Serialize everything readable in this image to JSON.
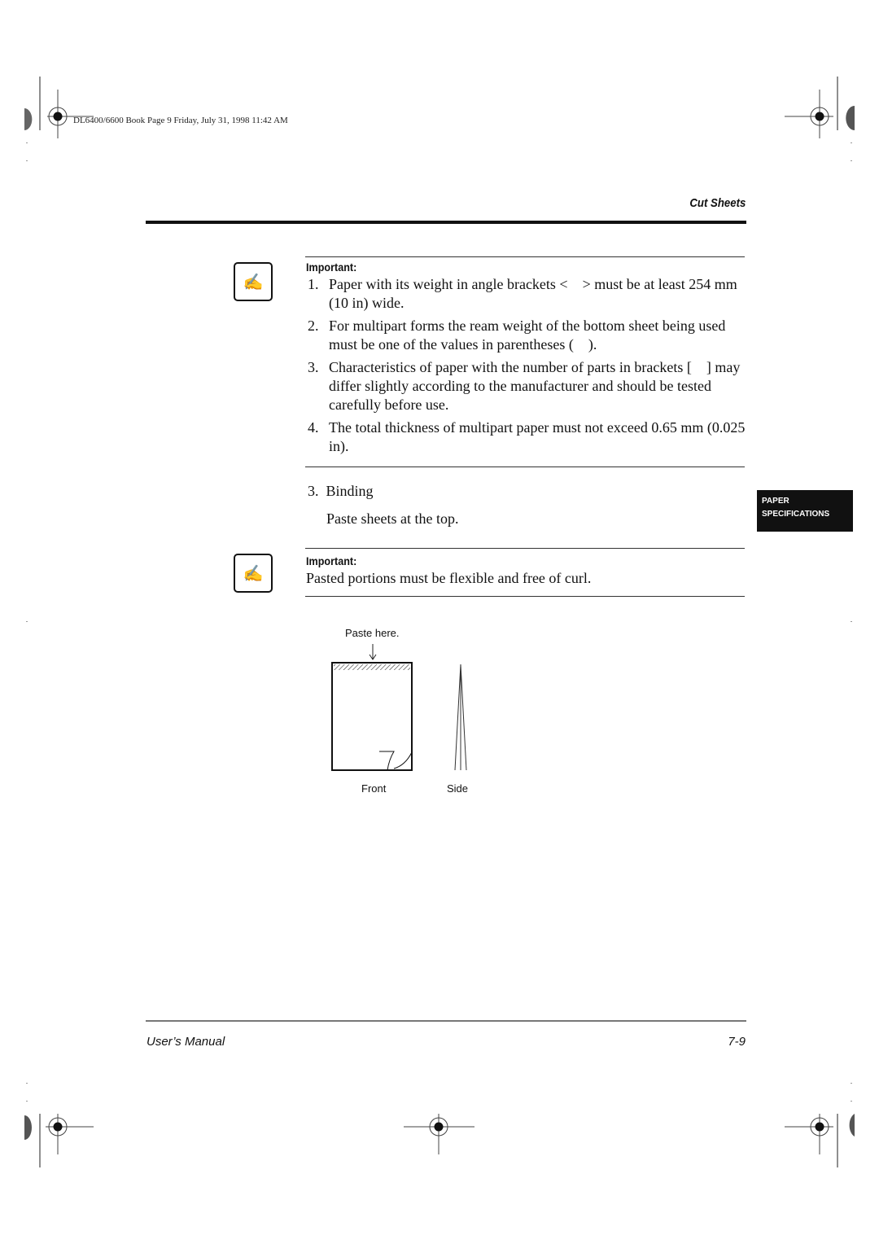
{
  "print_header": "DL6400/6600 Book  Page 9  Friday, July 31, 1998  11:42 AM",
  "section_title": "Cut Sheets",
  "side_tab": {
    "line1": "PAPER",
    "line2": "SPECIFICATIONS"
  },
  "important_1": {
    "icon": "pencil-hand-icon",
    "label": "Important:",
    "items": [
      {
        "num": "1.",
        "text": "Paper with its weight in angle brackets <    > must be at least 254 mm (10 in) wide."
      },
      {
        "num": "2.",
        "text": "For multipart forms the ream weight of the bottom sheet being used must be one of the values in parentheses (    )."
      },
      {
        "num": "3.",
        "text": "Characteristics of paper with the number of parts in brackets [    ] may differ slightly according to the manufacturer and should be tested carefully before use."
      },
      {
        "num": "4.",
        "text": "The total thickness of multipart paper must not exceed 0.65 mm (0.025 in)."
      }
    ]
  },
  "binding": {
    "num": "3.",
    "heading": "Binding",
    "text": "Paste sheets at the top."
  },
  "important_2": {
    "icon": "pencil-hand-icon",
    "label": "Important:",
    "text": "Pasted portions must be flexible and free of curl."
  },
  "figure": {
    "paste_label": "Paste here.",
    "front_label": "Front",
    "side_label": "Side"
  },
  "footer": {
    "left": "User’s Manual",
    "right": "7-9"
  }
}
